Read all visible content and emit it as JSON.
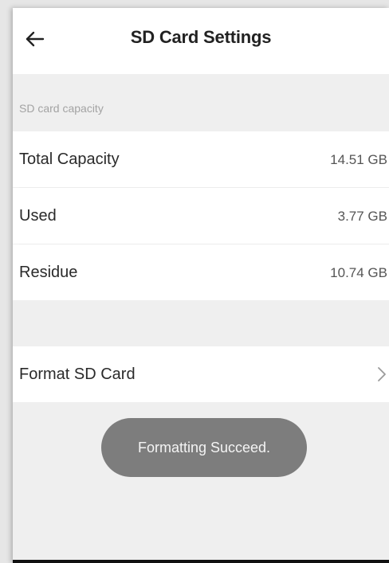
{
  "header": {
    "title": "SD Card Settings",
    "back_icon": "arrow-left-icon"
  },
  "capacity_section": {
    "label": "SD card capacity",
    "rows": [
      {
        "label": "Total Capacity",
        "value": "14.51 GB"
      },
      {
        "label": "Used",
        "value": "3.77 GB"
      },
      {
        "label": "Residue",
        "value": "10.74 GB"
      }
    ]
  },
  "format": {
    "label": "Format SD Card",
    "icon": "chevron-right-icon"
  },
  "toast": {
    "text": "Formatting Succeed."
  },
  "colors": {
    "background": "#efefef",
    "row_background": "#ffffff",
    "toast_background": "#7d7d7d",
    "secondary_text": "#a3a3a3"
  }
}
